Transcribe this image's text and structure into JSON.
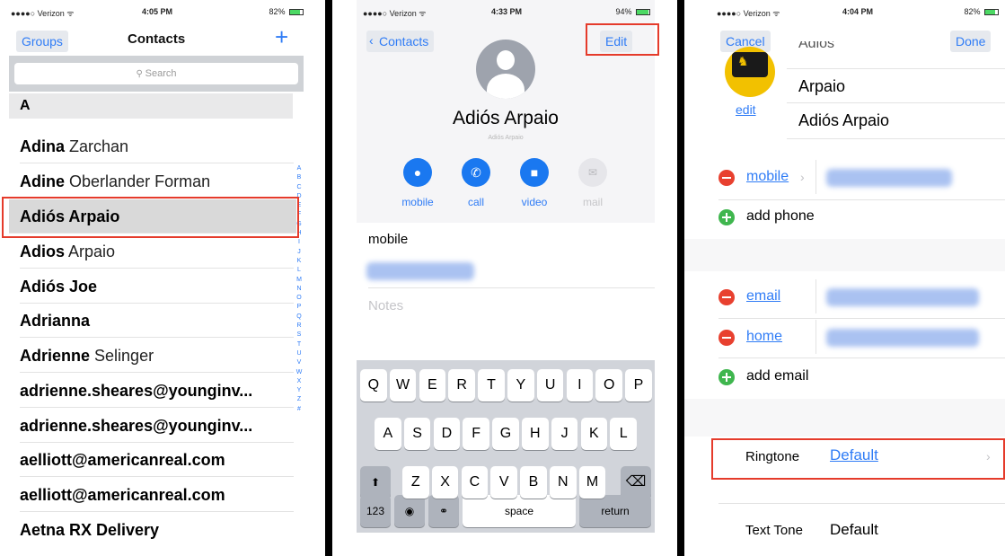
{
  "panel1": {
    "status": {
      "carrier": "●●●●○ Verizon ᯤ",
      "time": "4:05 PM",
      "battery": "82%"
    },
    "nav": {
      "left": "Groups",
      "title": "Contacts",
      "right": "+"
    },
    "search": {
      "placeholder": "Search"
    },
    "section_header": "A",
    "contacts": [
      {
        "first": "Adina",
        "last": "Zarchan"
      },
      {
        "first": "Adine",
        "last": "Oberlander Forman"
      },
      {
        "first": "Adiós Arpaio",
        "last": ""
      },
      {
        "first": "Adios",
        "last": "Arpaio"
      },
      {
        "first": "Adiós Joe",
        "last": ""
      },
      {
        "first": "Adrianna",
        "last": ""
      },
      {
        "first": "Adrienne",
        "last": "Selinger"
      },
      {
        "first": "adrienne.sheares@younginv...",
        "last": ""
      },
      {
        "first": "adrienne.sheares@younginv...",
        "last": ""
      },
      {
        "first": "aelliott@americanreal.com",
        "last": ""
      },
      {
        "first": "aelliott@americanreal.com",
        "last": ""
      },
      {
        "first": "Aetna RX Delivery",
        "last": ""
      }
    ],
    "index_letters": [
      "A",
      "B",
      "C",
      "D",
      "E",
      "F",
      "G",
      "H",
      "I",
      "J",
      "K",
      "L",
      "M",
      "N",
      "O",
      "P",
      "Q",
      "R",
      "S",
      "T",
      "U",
      "V",
      "W",
      "X",
      "Y",
      "Z",
      "#"
    ]
  },
  "panel2": {
    "status": {
      "carrier": "●●●●○ Verizon ᯤ",
      "time": "4:33 PM",
      "battery": "94%"
    },
    "nav": {
      "back": "Contacts",
      "edit": "Edit"
    },
    "name": "Adiós Arpaio",
    "subname": "Adiós Arpaio",
    "actions": [
      {
        "label": "mobile",
        "icon": "message-icon",
        "glyph": "●",
        "enabled": true
      },
      {
        "label": "call",
        "icon": "phone-icon",
        "glyph": "✆",
        "enabled": true
      },
      {
        "label": "video",
        "icon": "video-icon",
        "glyph": "■",
        "enabled": true
      },
      {
        "label": "mail",
        "icon": "mail-icon",
        "glyph": "✉",
        "enabled": false
      }
    ],
    "field_label": "mobile",
    "notes_placeholder": "Notes",
    "keyboard": {
      "row1": [
        "Q",
        "W",
        "E",
        "R",
        "T",
        "Y",
        "U",
        "I",
        "O",
        "P"
      ],
      "row2": [
        "A",
        "S",
        "D",
        "F",
        "G",
        "H",
        "J",
        "K",
        "L"
      ],
      "row3": [
        "Z",
        "X",
        "C",
        "V",
        "B",
        "N",
        "M"
      ],
      "shift": "⬆",
      "delete": "⌫",
      "numbers": "123",
      "globe": "🌐",
      "mic": "🎙",
      "space": "space",
      "return": "return"
    }
  },
  "panel3": {
    "status": {
      "carrier": "●●●●○ Verizon ᯤ",
      "time": "4:04 PM",
      "battery": "82%"
    },
    "nav": {
      "cancel": "Cancel",
      "done": "Done"
    },
    "photo_edit": "edit",
    "name_fields": {
      "partial": "Adios",
      "last": "Arpaio",
      "display": "Adiós Arpaio"
    },
    "phone_label": "mobile",
    "add_phone": "add phone",
    "email_labels": [
      "email",
      "home"
    ],
    "add_email": "add email",
    "ringtone": {
      "label": "Ringtone",
      "value": "Default"
    },
    "text_tone": {
      "label": "Text Tone",
      "value": "Default"
    }
  },
  "colors": {
    "accent": "#2f7cf6",
    "highlight": "#e53b2b",
    "remove": "#e8402f",
    "add": "#3fb64e"
  }
}
